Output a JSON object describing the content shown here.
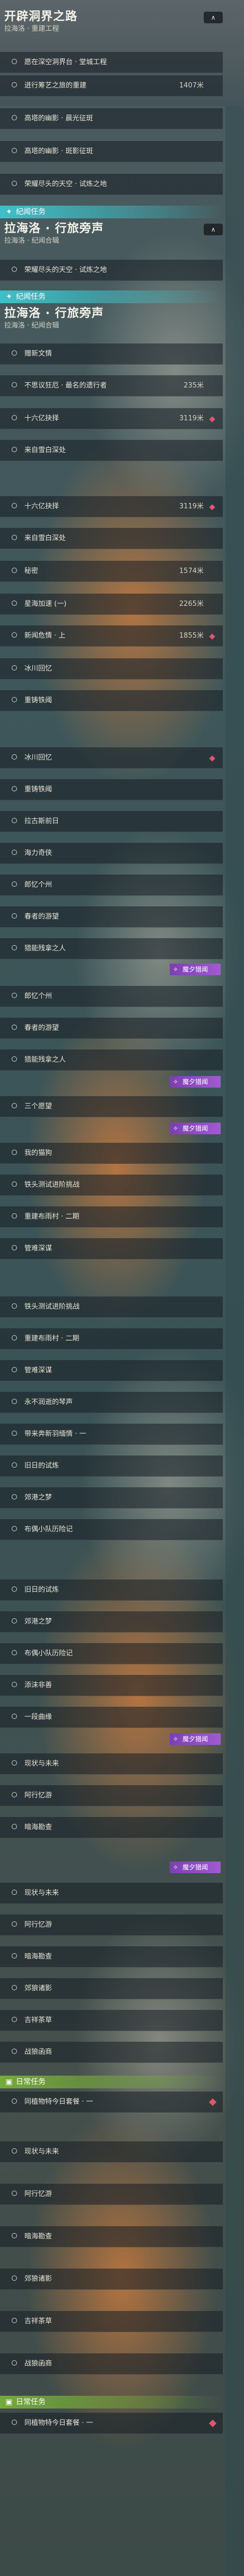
{
  "colors": {
    "teal": "#3ec6ce",
    "green": "#78b03a",
    "red_marker": "#e2566a",
    "purple_badge": "#8a46c0"
  },
  "icons": {
    "collapse": "chevron-up-icon",
    "marker": "red-diamond-marker-icon",
    "pin": "location-pin-icon",
    "badge": "wand-icon"
  },
  "h1": {
    "title": "开辟洞界之路",
    "subtitle": "拉海洛 · 重建工程",
    "collapse": "∧"
  },
  "h2": {
    "title": "拉海洛 · 行旅旁声",
    "subtitle": "拉海洛 · 纪闻合辑",
    "collapse": "∧"
  },
  "list1": [
    {
      "label": "愿在深空洞界台 · 堂城工程",
      "dist": ""
    },
    {
      "label": "迸行筹艺之旅的重建",
      "dist": "1407米"
    },
    {
      "label": "高塔的幽影 · 晨光征斑",
      "dist": ""
    },
    {
      "label": "高塔的幽影 · 斑影征斑",
      "dist": ""
    },
    {
      "label": "荣耀尽头的天空 · 试炼之地",
      "dist": ""
    }
  ],
  "sec1": "纪闻任务",
  "ghost1": [
    {
      "label": "荣耀尽头的天空 · 试炼之地"
    }
  ],
  "sec2": "纪闻任务",
  "list2": [
    {
      "label": "赠新文情",
      "dist": ""
    },
    {
      "label": "不思议狂厄 · 最名的遗行者",
      "dist": "235米"
    },
    {
      "label": "十六亿抉择",
      "dist": "3119米"
    },
    {
      "label": "来自雪白深处",
      "dist": ""
    }
  ],
  "list3": [
    {
      "label": "十六亿抉择",
      "dist": "3119米"
    },
    {
      "label": "来自雪白深处",
      "dist": ""
    },
    {
      "label": "秘密",
      "dist": "1574米"
    },
    {
      "label": "星海加速 (一)",
      "dist": "2265米"
    },
    {
      "label": "新闻危情 · 上",
      "dist": "1855米"
    },
    {
      "label": "冰川回忆",
      "dist": ""
    },
    {
      "label": "重铸铁阈",
      "dist": ""
    }
  ],
  "list4": [
    {
      "label": "冰川回忆",
      "dist": ""
    },
    {
      "label": "重铸铁阈",
      "dist": ""
    },
    {
      "label": "拉古斯前日",
      "dist": ""
    },
    {
      "label": "海力奇侠",
      "dist": ""
    },
    {
      "label": "郎忆个州",
      "dist": ""
    },
    {
      "label": "春者的游望",
      "dist": ""
    },
    {
      "label": "猎能残拿之人",
      "dist": ""
    }
  ],
  "badge_label": "魔夕猎闻",
  "list5": [
    {
      "label": "郎忆个州",
      "dist": ""
    },
    {
      "label": "春者的游望",
      "dist": ""
    },
    {
      "label": "猎能残拿之人",
      "dist": ""
    },
    {
      "label": "三个愿望",
      "dist": ""
    },
    {
      "label": "我的猫狗",
      "dist": ""
    },
    {
      "label": "铁头测试进阶挑战",
      "dist": ""
    },
    {
      "label": "重建布雨村 · 二期",
      "dist": ""
    },
    {
      "label": "管难深谋",
      "dist": ""
    }
  ],
  "list6": [
    {
      "label": "铁头测试进阶挑战",
      "dist": ""
    },
    {
      "label": "重建布雨村 · 二期",
      "dist": ""
    },
    {
      "label": "管难深谋",
      "dist": ""
    },
    {
      "label": "永不润逝的琴声",
      "dist": ""
    },
    {
      "label": "带来奔新羽缅情 · 一",
      "dist": ""
    },
    {
      "label": "旧日的试炼",
      "dist": ""
    },
    {
      "label": "郊港之梦",
      "dist": ""
    },
    {
      "label": "布偶小队历险记",
      "dist": ""
    }
  ],
  "list7": [
    {
      "label": "旧日的试炼",
      "dist": ""
    },
    {
      "label": "郊港之梦",
      "dist": ""
    },
    {
      "label": "布偶小队历险记",
      "dist": ""
    },
    {
      "label": "添沫非善",
      "dist": ""
    },
    {
      "label": "一段曲缘",
      "dist": ""
    },
    {
      "label": "现状与未来",
      "dist": ""
    },
    {
      "label": "阿行忆游",
      "dist": ""
    },
    {
      "label": "暗海勘查",
      "dist": ""
    }
  ],
  "list8": [
    {
      "label": "现状与未来",
      "dist": ""
    },
    {
      "label": "阿行忆游",
      "dist": ""
    },
    {
      "label": "暗海勘查",
      "dist": ""
    },
    {
      "label": "郊狼诸影",
      "dist": ""
    },
    {
      "label": "吉祥茶草",
      "dist": ""
    },
    {
      "label": "战狼函商",
      "dist": ""
    }
  ],
  "sec_daily1": "日常任务",
  "daily1": [
    {
      "label": "同植物特今日套餐 · 一",
      "dist": ""
    }
  ],
  "list9": [
    {
      "label": "现状与未来",
      "dist": ""
    },
    {
      "label": "阿行忆游",
      "dist": ""
    },
    {
      "label": "暗海勘查",
      "dist": ""
    },
    {
      "label": "郊狼诸影",
      "dist": ""
    },
    {
      "label": "吉祥茶草",
      "dist": ""
    },
    {
      "label": "战狼函商",
      "dist": ""
    }
  ],
  "sec_daily2": "日常任务",
  "daily2": [
    {
      "label": "同植物特今日套餐 · 一",
      "dist": ""
    }
  ]
}
